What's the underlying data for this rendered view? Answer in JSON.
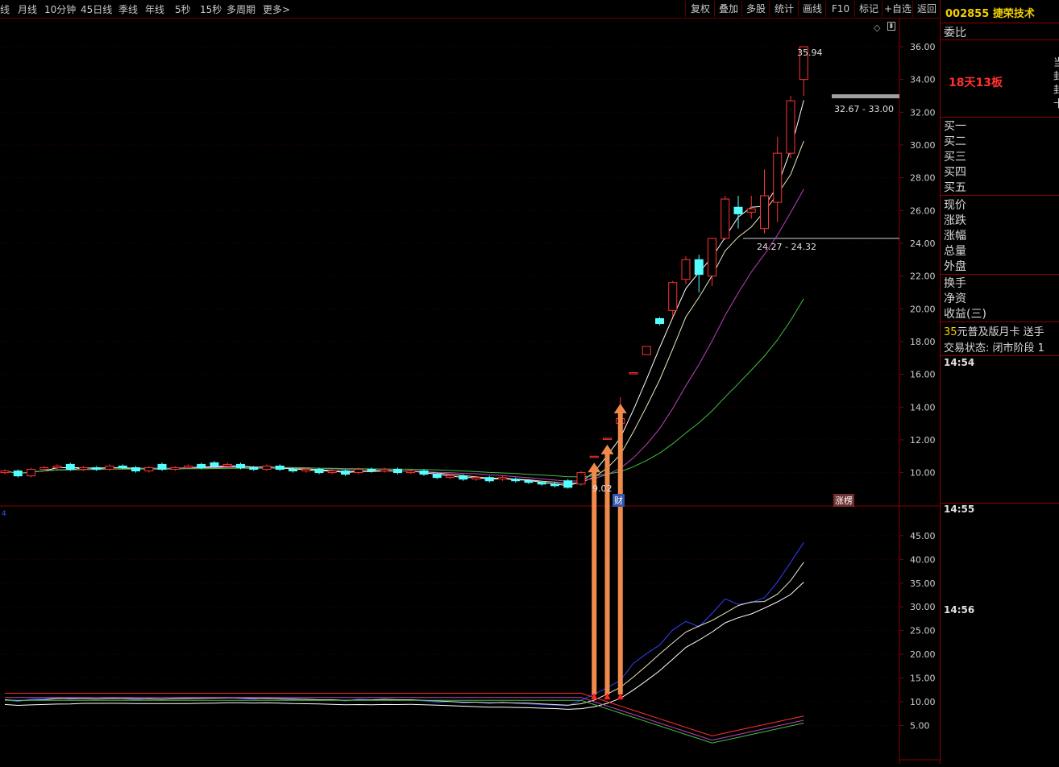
{
  "toolbar": {
    "period_tabs": [
      "线",
      "月线",
      "10分钟",
      "45日线",
      "季线",
      "年线",
      "5秒",
      "15秒",
      "多周期",
      "更多>"
    ],
    "buttons": [
      "复权",
      "叠加",
      "多股",
      "统计",
      "画线",
      "F10",
      "标记",
      "+自选",
      "返回"
    ]
  },
  "stock": {
    "code": "002855",
    "name": "捷荣技术"
  },
  "chart_labels": {
    "high_price": "35.94",
    "top_range": "32.67 - 33.00",
    "mid_range": "24.27 - 24.32",
    "low_price": "9.02",
    "cai_badge": "财",
    "zhangting_badge": "涨楞",
    "left_marker": "4"
  },
  "price_axis": [
    "36.00",
    "34.00",
    "32.00",
    "30.00",
    "28.00",
    "26.00",
    "24.00",
    "22.00",
    "20.00",
    "18.00",
    "16.00",
    "14.00",
    "12.00",
    "10.00"
  ],
  "indicator_axis": [
    "45.00",
    "40.00",
    "35.00",
    "30.00",
    "25.00",
    "20.00",
    "15.00",
    "10.00",
    "5.00"
  ],
  "right_panel": {
    "weibi_label": "委比",
    "badge_text": "18天13板",
    "side_text": [
      "当",
      "封",
      "封",
      "十"
    ],
    "buy_labels": [
      "买一",
      "买二",
      "买三",
      "买四",
      "买五"
    ],
    "quote_labels": [
      "现价",
      "涨跌",
      "涨幅",
      "总量",
      "外盘"
    ],
    "fundamental_labels": [
      "换手",
      "净资",
      "收益(三)"
    ],
    "promo_number": "35",
    "promo_text": "元普及版月卡 送手",
    "trade_status": "交易状态: 闭市阶段 1",
    "times": [
      "14:54",
      "14:55",
      "14:56"
    ]
  },
  "colors": {
    "up": "#ff3232",
    "down": "#54ffff",
    "grid": "#8a0000",
    "arrow": "#f08a4b",
    "ma1": "#ffffff",
    "ma2": "#e8e8c0",
    "ma3": "#c040c0",
    "ma4": "#40c040"
  },
  "chart_data": {
    "type": "candlestick",
    "price_range": [
      8.5,
      37
    ],
    "indicator_range": [
      0,
      50
    ],
    "candles": [
      {
        "o": 10.0,
        "c": 10.1,
        "h": 10.2,
        "l": 9.9
      },
      {
        "o": 10.1,
        "c": 9.8,
        "h": 10.2,
        "l": 9.7
      },
      {
        "o": 9.8,
        "c": 10.2,
        "h": 10.3,
        "l": 9.7
      },
      {
        "o": 10.2,
        "c": 10.3,
        "h": 10.4,
        "l": 10.1
      },
      {
        "o": 10.3,
        "c": 10.4,
        "h": 10.5,
        "l": 10.2
      },
      {
        "o": 10.5,
        "c": 10.2,
        "h": 10.6,
        "l": 10.1
      },
      {
        "o": 10.2,
        "c": 10.3,
        "h": 10.4,
        "l": 10.1
      },
      {
        "o": 10.3,
        "c": 10.2,
        "h": 10.4,
        "l": 10.1
      },
      {
        "o": 10.2,
        "c": 10.4,
        "h": 10.5,
        "l": 10.1
      },
      {
        "o": 10.4,
        "c": 10.3,
        "h": 10.5,
        "l": 10.2
      },
      {
        "o": 10.3,
        "c": 10.1,
        "h": 10.4,
        "l": 10.0
      },
      {
        "o": 10.1,
        "c": 10.3,
        "h": 10.4,
        "l": 10.0
      },
      {
        "o": 10.5,
        "c": 10.2,
        "h": 10.6,
        "l": 10.1
      },
      {
        "o": 10.2,
        "c": 10.3,
        "h": 10.4,
        "l": 10.1
      },
      {
        "o": 10.3,
        "c": 10.4,
        "h": 10.5,
        "l": 10.2
      },
      {
        "o": 10.5,
        "c": 10.3,
        "h": 10.6,
        "l": 10.2
      },
      {
        "o": 10.6,
        "c": 10.4,
        "h": 10.7,
        "l": 10.3
      },
      {
        "o": 10.4,
        "c": 10.5,
        "h": 10.6,
        "l": 10.3
      },
      {
        "o": 10.5,
        "c": 10.3,
        "h": 10.6,
        "l": 10.2
      },
      {
        "o": 10.3,
        "c": 10.2,
        "h": 10.4,
        "l": 10.1
      },
      {
        "o": 10.2,
        "c": 10.4,
        "h": 10.5,
        "l": 10.1
      },
      {
        "o": 10.4,
        "c": 10.2,
        "h": 10.5,
        "l": 10.1
      },
      {
        "o": 10.2,
        "c": 10.1,
        "h": 10.3,
        "l": 10.0
      },
      {
        "o": 10.1,
        "c": 10.2,
        "h": 10.3,
        "l": 10.0
      },
      {
        "o": 10.2,
        "c": 10.0,
        "h": 10.3,
        "l": 9.9
      },
      {
        "o": 10.0,
        "c": 10.1,
        "h": 10.2,
        "l": 9.9
      },
      {
        "o": 10.1,
        "c": 9.9,
        "h": 10.2,
        "l": 9.8
      },
      {
        "o": 10.0,
        "c": 10.2,
        "h": 10.3,
        "l": 9.9
      },
      {
        "o": 10.2,
        "c": 10.1,
        "h": 10.3,
        "l": 10.0
      },
      {
        "o": 10.1,
        "c": 10.2,
        "h": 10.3,
        "l": 10.0
      },
      {
        "o": 10.2,
        "c": 10.0,
        "h": 10.3,
        "l": 9.9
      },
      {
        "o": 10.0,
        "c": 10.1,
        "h": 10.2,
        "l": 9.9
      },
      {
        "o": 10.1,
        "c": 9.9,
        "h": 10.2,
        "l": 9.8
      },
      {
        "o": 9.9,
        "c": 9.7,
        "h": 10.0,
        "l": 9.6
      },
      {
        "o": 9.7,
        "c": 9.8,
        "h": 9.9,
        "l": 9.6
      },
      {
        "o": 9.8,
        "c": 9.6,
        "h": 9.9,
        "l": 9.5
      },
      {
        "o": 9.6,
        "c": 9.7,
        "h": 9.8,
        "l": 9.5
      },
      {
        "o": 9.7,
        "c": 9.5,
        "h": 9.8,
        "l": 9.4
      },
      {
        "o": 9.6,
        "c": 9.7,
        "h": 9.8,
        "l": 9.5
      },
      {
        "o": 9.6,
        "c": 9.5,
        "h": 9.7,
        "l": 9.4
      },
      {
        "o": 9.5,
        "c": 9.4,
        "h": 9.6,
        "l": 9.3
      },
      {
        "o": 9.4,
        "c": 9.3,
        "h": 9.5,
        "l": 9.2
      },
      {
        "o": 9.3,
        "c": 9.2,
        "h": 9.4,
        "l": 9.1
      },
      {
        "o": 9.5,
        "c": 9.1,
        "h": 9.6,
        "l": 9.02
      },
      {
        "o": 9.3,
        "c": 10.0,
        "h": 10.1,
        "l": 9.2
      },
      {
        "o": 11.0,
        "c": 11.0,
        "h": 11.0,
        "l": 11.0
      },
      {
        "o": 12.1,
        "c": 12.1,
        "h": 12.1,
        "l": 12.1
      },
      {
        "o": 13.0,
        "c": 13.3,
        "h": 14.6,
        "l": 12.9
      },
      {
        "o": 16.1,
        "c": 16.1,
        "h": 16.1,
        "l": 16.1
      },
      {
        "o": 17.2,
        "c": 17.7,
        "h": 17.7,
        "l": 17.2
      },
      {
        "o": 19.4,
        "c": 19.1,
        "h": 19.5,
        "l": 19.0
      },
      {
        "o": 19.9,
        "c": 21.6,
        "h": 21.7,
        "l": 19.5
      },
      {
        "o": 21.8,
        "c": 23.0,
        "h": 23.2,
        "l": 21.5
      },
      {
        "o": 23.0,
        "c": 22.1,
        "h": 23.3,
        "l": 21.0
      },
      {
        "o": 22.0,
        "c": 24.3,
        "h": 24.3,
        "l": 21.4
      },
      {
        "o": 24.3,
        "c": 26.7,
        "h": 26.9,
        "l": 24.2
      },
      {
        "o": 26.2,
        "c": 25.8,
        "h": 26.9,
        "l": 24.9
      },
      {
        "o": 25.9,
        "c": 26.1,
        "h": 26.9,
        "l": 25.5
      },
      {
        "o": 24.9,
        "c": 26.9,
        "h": 28.5,
        "l": 24.6
      },
      {
        "o": 26.5,
        "c": 29.5,
        "h": 30.5,
        "l": 25.3
      },
      {
        "o": 29.5,
        "c": 32.7,
        "h": 33.0,
        "l": 29.2
      },
      {
        "o": 34.0,
        "c": 36.0,
        "h": 36.0,
        "l": 33.0
      }
    ],
    "arrow_candles": [
      45,
      46,
      47
    ]
  }
}
